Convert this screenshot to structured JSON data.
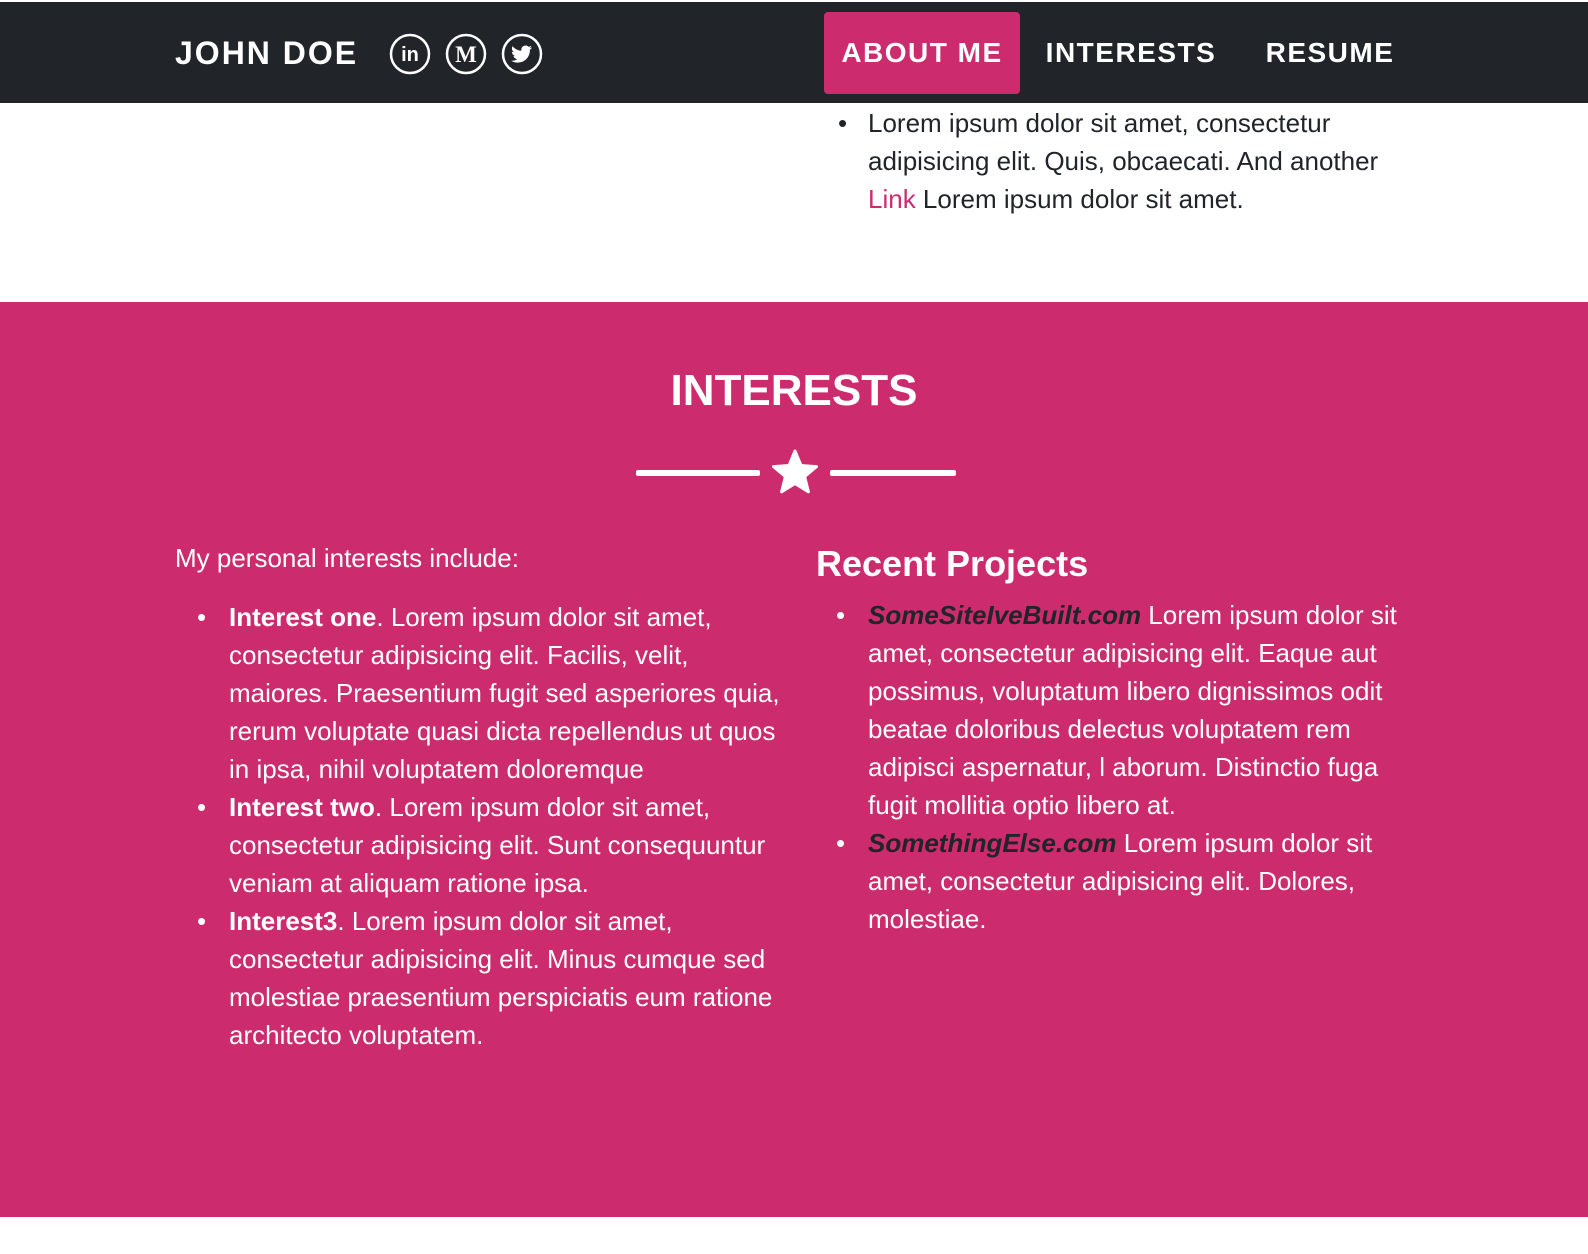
{
  "nav": {
    "brand": "JOHN DOE",
    "social": [
      {
        "icon": "linkedin-icon",
        "glyph": "in"
      },
      {
        "icon": "medium-icon",
        "glyph": "M"
      },
      {
        "icon": "twitter-icon"
      }
    ],
    "items": [
      {
        "label": "ABOUT ME",
        "active": true
      },
      {
        "label": "INTERESTS",
        "active": false
      },
      {
        "label": "RESUME",
        "active": false
      }
    ]
  },
  "about_continued": {
    "before_link": "Lorem ipsum dolor sit amet, consectetur adipisicing elit. Quis, obcaecati. And another ",
    "link_text": "Link",
    "after_link": " Lorem ipsum dolor sit amet."
  },
  "interests": {
    "title": "INTERESTS",
    "divider_icon": "star-icon",
    "intro": "My personal interests include:",
    "items": [
      {
        "name": "Interest one",
        "text": ". Lorem ipsum dolor sit amet, consectetur adipisicing elit. Facilis, velit, maiores. Praesentium fugit sed asperiores quia, rerum voluptate quasi dicta repellendus ut quos in ipsa, nihil voluptatem doloremque"
      },
      {
        "name": "Interest two",
        "text": ". Lorem ipsum dolor sit amet, consectetur adipisicing elit. Sunt consequuntur veniam at aliquam ratione ipsa."
      },
      {
        "name": "Interest3",
        "text": ". Lorem ipsum dolor sit amet, consectetur adipisicing elit. Minus cumque sed molestiae praesentium perspiciatis eum ratione architecto voluptatem."
      }
    ]
  },
  "projects": {
    "title": "Recent Projects",
    "items": [
      {
        "site": "SomeSiteIveBuilt.com",
        "text": " Lorem ipsum dolor sit amet, consectetur adipisicing elit. Eaque aut possimus, voluptatum libero dignissimos odit beatae doloribus delectus voluptatem rem adipisci aspernatur, l aborum. Distinctio fuga fugit mollitia optio libero at."
      },
      {
        "site": "SomethingElse.com",
        "text": " Lorem ipsum dolor sit amet, consectetur adipisicing elit. Dolores, molestiae."
      }
    ]
  },
  "colors": {
    "navbar": "#212529",
    "accent": "#cc2b6e",
    "text": "#212529",
    "inverse": "#ffffff"
  },
  "bullet_char": "•"
}
